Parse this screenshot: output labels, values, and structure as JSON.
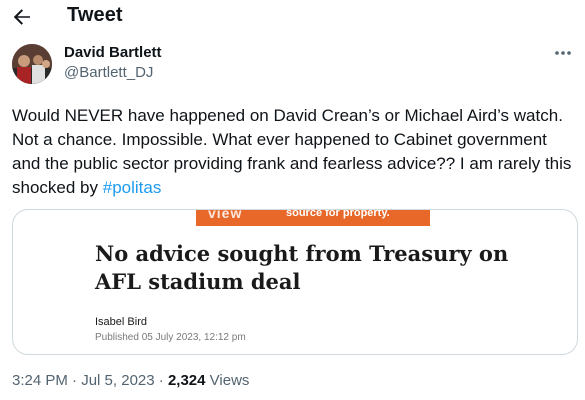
{
  "header": {
    "title": "Tweet",
    "back_icon": "arrow-left-icon"
  },
  "author": {
    "name": "David Bartlett",
    "handle": "@Bartlett_DJ",
    "more_icon": "more-dots-icon"
  },
  "tweet": {
    "text": "Would NEVER have happened on David Crean’s or Michael Aird’s watch. Not a chance.  Impossible.  What ever happened to Cabinet government and the public sector providing frank and fearless advice?? I am rarely this shocked by ",
    "hashtag": "#politas"
  },
  "card": {
    "banner_logo": "view",
    "banner_text": "source for property.",
    "headline": "No advice sought from Treasury on AFL stadium deal",
    "author": "Isabel Bird",
    "published": "Published 05 July 2023, 12:12 pm"
  },
  "meta": {
    "time": "3:24 PM",
    "separator": " · ",
    "date": "Jul 5, 2023",
    "views_count": "2,324",
    "views_label": " Views"
  },
  "colors": {
    "accent": "#1d9bf0",
    "muted": "#536471",
    "banner": "#e8682a"
  }
}
